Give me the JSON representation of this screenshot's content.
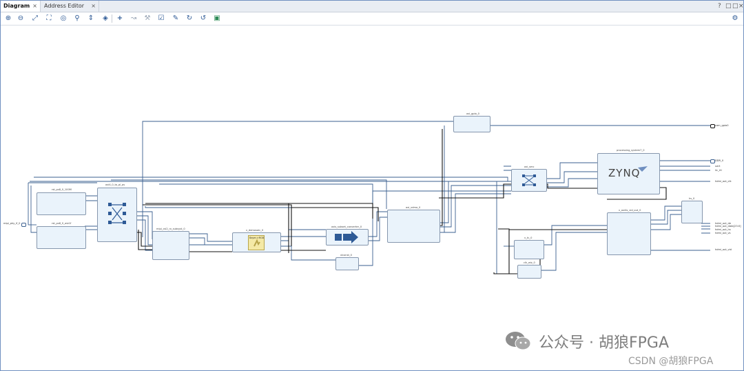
{
  "tabs": [
    {
      "label": "Diagram",
      "close": "×"
    },
    {
      "label": "Address Editor",
      "close": "×"
    }
  ],
  "window_controls": [
    "?",
    "□",
    "□",
    "×"
  ],
  "toolbar_icons": [
    "zoom-in-icon",
    "zoom-out-icon",
    "zoom-fit-icon",
    "zoom-selection-icon",
    "auto-connect-icon",
    "search-icon",
    "collapse-icon",
    "expand-icon",
    "add-ip-icon",
    "make-connection-icon",
    "wrench-icon",
    "validate-icon",
    "pin-icon",
    "regenerate-icon",
    "refresh-icon",
    "chip-icon",
    "settings-icon"
  ],
  "blocks": {
    "rst_ps8_0_100m": "rst_ps8_0_100M",
    "rst_ps8_0_wiz": "rst_ps8_0_wiz1f",
    "axi_interconnect": "axi4_0_to_pl_ps",
    "mipi_csi2_rx": "mipi_csi2_rx_subsyst_0",
    "v_demosaic": "v_demosaic_0",
    "demosaic_text": "Bayer->RGB",
    "axis_subset": "axis_subset_converter_0",
    "xlconst": "xlconst_0",
    "axi_vdma": "axi_vdma_0",
    "axi_gpio": "axi_gpio_0",
    "axi_smc": "axi_smc",
    "processing_system": "processing_system7_0",
    "zynq_text": "ZYNQ",
    "v_tc": "v_tc_0",
    "clk_wiz": "clk_wiz_0",
    "v_axi4s_vid_out": "v_axi4s_vid_out_0",
    "rgb2dvi": "hs_0"
  },
  "ports": {
    "mipi_phy": "mipi_phy_if_0",
    "cam_gpio": "cam_gpio0",
    "ddr": "DDR_0",
    "ports_right": [
      "uart",
      "iic_rtl"
    ],
    "hdmi_out_clk": "hdmi_out_clk",
    "hdmi_right": [
      "hdmi_out_de",
      "hdmi_out_data[23:0]",
      "hdmi_out_hs",
      "hdmi_out_vs"
    ],
    "hdmi_out_vid": "hdmi_out_vid"
  },
  "watermark": {
    "channel": "公众号 · 胡狼FPGA",
    "csdn": "CSDN @胡狼FPGA"
  }
}
